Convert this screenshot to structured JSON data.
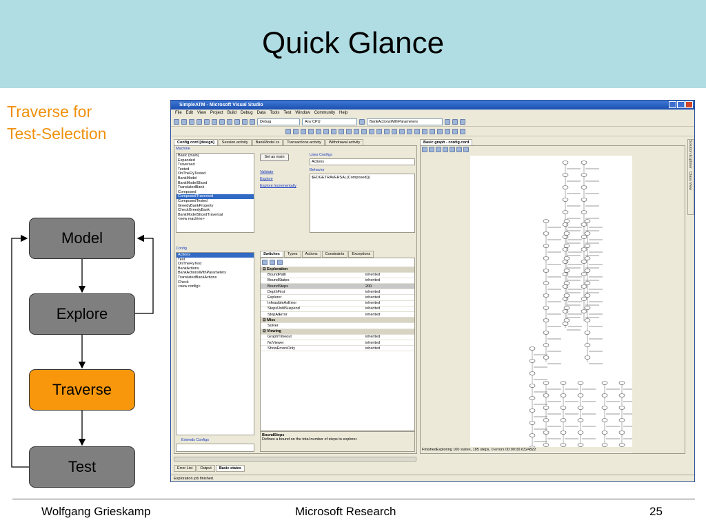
{
  "slide": {
    "title": "Quick Glance",
    "side_title_line1": "Traverse for",
    "side_title_line2": "Test-Selection"
  },
  "diagram": {
    "boxes": [
      "Model",
      "Explore",
      "Traverse",
      "Test"
    ],
    "highlight_color": "#f8970c",
    "box_color": "#7f7f7f"
  },
  "footer": {
    "author": "Wolfgang Grieskamp",
    "org": "Microsoft Research",
    "page": "25"
  },
  "vs": {
    "window_title": "SimpleATM - Microsoft Visual Studio",
    "menu": [
      "File",
      "Edit",
      "View",
      "Project",
      "Build",
      "Debug",
      "Data",
      "Tools",
      "Test",
      "Window",
      "Community",
      "Help"
    ],
    "config_combo": "Debug",
    "platform_combo": "Any CPU",
    "target_combo": "BankActionsWithParameters",
    "doc_tabs": [
      "Config.cord [design]",
      "Session.activity",
      "BankModel.cs",
      "Transactions.activity",
      "Withdrawal.activity"
    ],
    "graph_tab": "Basic graph - config.cord",
    "machine_label": "Machine",
    "machines": [
      "Basic (main)",
      "Expanded",
      "Traversed",
      "Tested",
      "OnTheFlyTested",
      "BankModel",
      "BankModelSliced",
      "TranslatedBank",
      "Composed",
      "ComposedTraversed",
      "ComposedTested",
      "GreedyBankProperty",
      "CheckGreedyBank",
      "BankModelSlicedTraversal",
      "<new machine>"
    ],
    "selected_machine": "ComposedTraversed",
    "set_main_button": "Set as main",
    "uses_configs_label": "Uses Configs",
    "uses_configs_value": "Actions",
    "links": [
      "Validate",
      "Explore",
      "Explore Incrementally"
    ],
    "behavior_label": "Behavior",
    "behavior_value": "$EDGETRAVERSAL(Composed())",
    "config_label": "Config",
    "configs": [
      "Actions",
      "Test",
      "OnTheFlyTest",
      "BankActions",
      "BankActionsWithParameters",
      "TranslatedBankActions",
      "Check",
      "<new config>"
    ],
    "selected_config": "Actions",
    "extends_label": "Extends Configs",
    "prop_tabs": [
      "Switches",
      "Types",
      "Actions",
      "Constraints",
      "Exceptions"
    ],
    "properties": [
      {
        "name": "Exploration",
        "value": "",
        "cat": true
      },
      {
        "name": "BoundPath",
        "value": "inherited"
      },
      {
        "name": "BoundStates",
        "value": "inherited"
      },
      {
        "name": "BoundSteps",
        "value": "200",
        "hl": true
      },
      {
        "name": "DepthFirst",
        "value": "inherited"
      },
      {
        "name": "Explorer",
        "value": "inherited"
      },
      {
        "name": "InfeasibleAsError",
        "value": "inherited"
      },
      {
        "name": "StepsUntilSuspend",
        "value": "inherited"
      },
      {
        "name": "StopAtError",
        "value": "inherited"
      },
      {
        "name": "Misc",
        "value": "",
        "cat": true
      },
      {
        "name": "Solver",
        "value": ""
      },
      {
        "name": "Viewing",
        "value": "",
        "cat": true
      },
      {
        "name": "GraphTimeout",
        "value": "inherited"
      },
      {
        "name": "NoViewer",
        "value": "inherited"
      },
      {
        "name": "ShowErrorsOnly",
        "value": "inherited"
      }
    ],
    "desc_title": "BoundSteps",
    "desc_text": "Defines a bound on the total number of steps to explorer.",
    "graph_status": "FinishedExploring   100 states, 105 steps, 0 errors   00:00:00.6324822",
    "bottom_tabs": [
      "Error List",
      "Output",
      "Basic states"
    ],
    "status_text": "Exploration job finished.",
    "side_panel": [
      "Solution Explorer",
      "Class View"
    ]
  }
}
